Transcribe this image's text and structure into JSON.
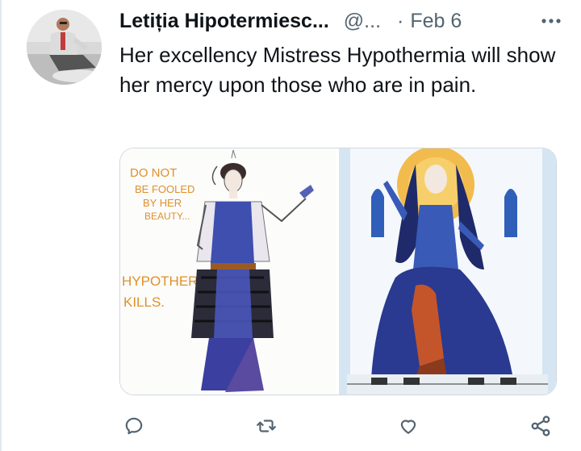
{
  "tweet": {
    "author_name": "Letiția Hipotermiesc...",
    "handle": "@...",
    "separator": "·",
    "date": "Feb 6",
    "more_label": "•••",
    "text": "Her excellency Mistress Hypothermia will show her mercy upon those who are in pain."
  },
  "media": {
    "left_caption_1": "DO NOT BE FOOLED BY HER BEAUTY...",
    "left_caption_2": "HYPOTHERMIA KILLS."
  },
  "actions": {
    "icons": [
      "reply-icon",
      "retweet-icon",
      "like-icon",
      "share-icon"
    ]
  },
  "colors": {
    "text": "#0f1419",
    "secondary": "#536471",
    "border": "#cfd9de",
    "icon": "#536471",
    "caption_orange": "#e0902a",
    "dress_blue": "#3e4fb0",
    "halo_gold": "#f2b43a",
    "robe_red": "#c4552a"
  }
}
